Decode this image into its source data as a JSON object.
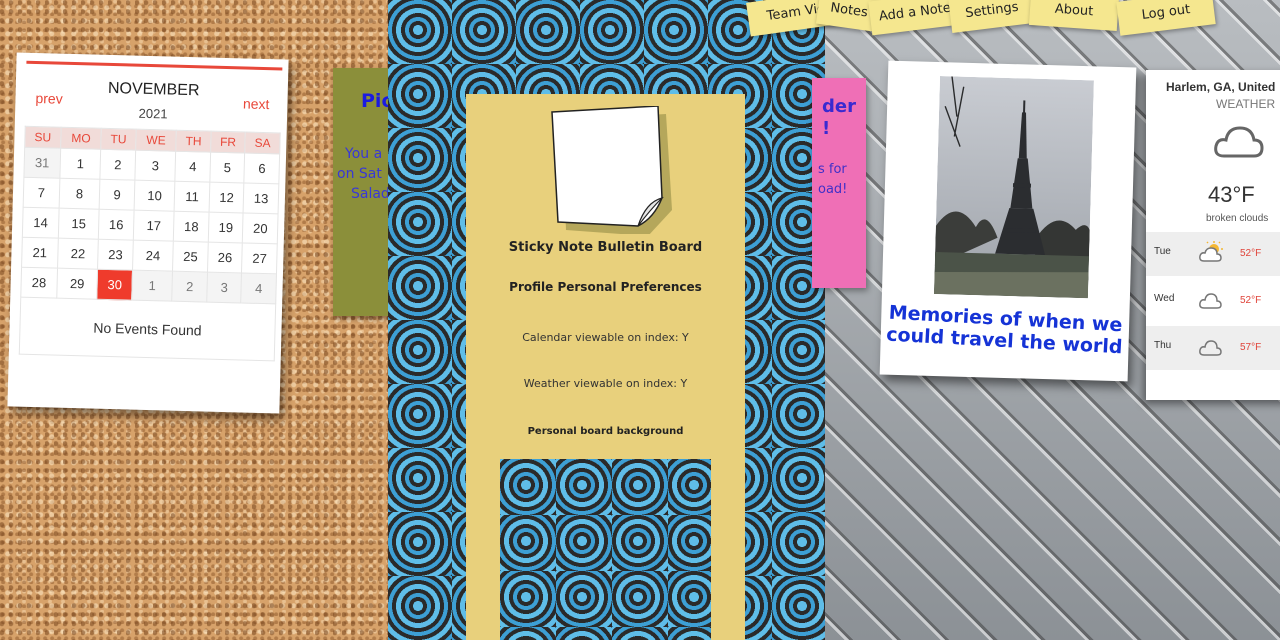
{
  "calendar": {
    "prev_label": "prev",
    "next_label": "next",
    "month": "NOVEMBER",
    "year": "2021",
    "weekdays": [
      "SU",
      "MO",
      "TU",
      "WE",
      "TH",
      "FR",
      "SA"
    ],
    "weeks": [
      [
        "31",
        "1",
        "2",
        "3",
        "4",
        "5",
        "6"
      ],
      [
        "7",
        "8",
        "9",
        "10",
        "11",
        "12",
        "13"
      ],
      [
        "14",
        "15",
        "16",
        "17",
        "18",
        "19",
        "20"
      ],
      [
        "21",
        "22",
        "23",
        "24",
        "25",
        "26",
        "27"
      ],
      [
        "28",
        "29",
        "30",
        "1",
        "2",
        "3",
        "4"
      ]
    ],
    "today": "30",
    "empty_message": "No Events Found",
    "accent_color": "#e8483a"
  },
  "olive_note": {
    "title": "Pic",
    "lines": [
      "You a",
      "on Sat",
      "Salad"
    ],
    "color": "#8b8f3a"
  },
  "nav": {
    "items": [
      "Team Vie",
      "Notes",
      "Add a Note",
      "Settings",
      "About",
      "Log out"
    ],
    "color": "#f5e78f"
  },
  "profile": {
    "brand": "Sticky Note Bulletin Board",
    "heading": "Profile Personal Preferences",
    "calendar_pref": "Calendar viewable on index: Y",
    "weather_pref": "Weather viewable on index: Y",
    "background_label": "Personal board background",
    "card_color": "#e8d07c"
  },
  "pink_note": {
    "title_lines": [
      "der",
      "!"
    ],
    "body_lines": [
      "s for",
      "oad!"
    ],
    "color": "#ef6fb6"
  },
  "photo": {
    "caption": "Memories of when we could travel the world",
    "subject": "eiffel-tower-photo"
  },
  "weather": {
    "location": "Harlem, GA, United",
    "label": "WEATHER",
    "current_temp": "43°F",
    "description": "broken clouds",
    "forecast": [
      {
        "day": "Tue",
        "high": "52°F",
        "icon": "partly-sunny-icon"
      },
      {
        "day": "Wed",
        "high": "52°F",
        "icon": "cloud-icon"
      },
      {
        "day": "Thu",
        "high": "57°F",
        "icon": "cloud-icon"
      }
    ]
  }
}
